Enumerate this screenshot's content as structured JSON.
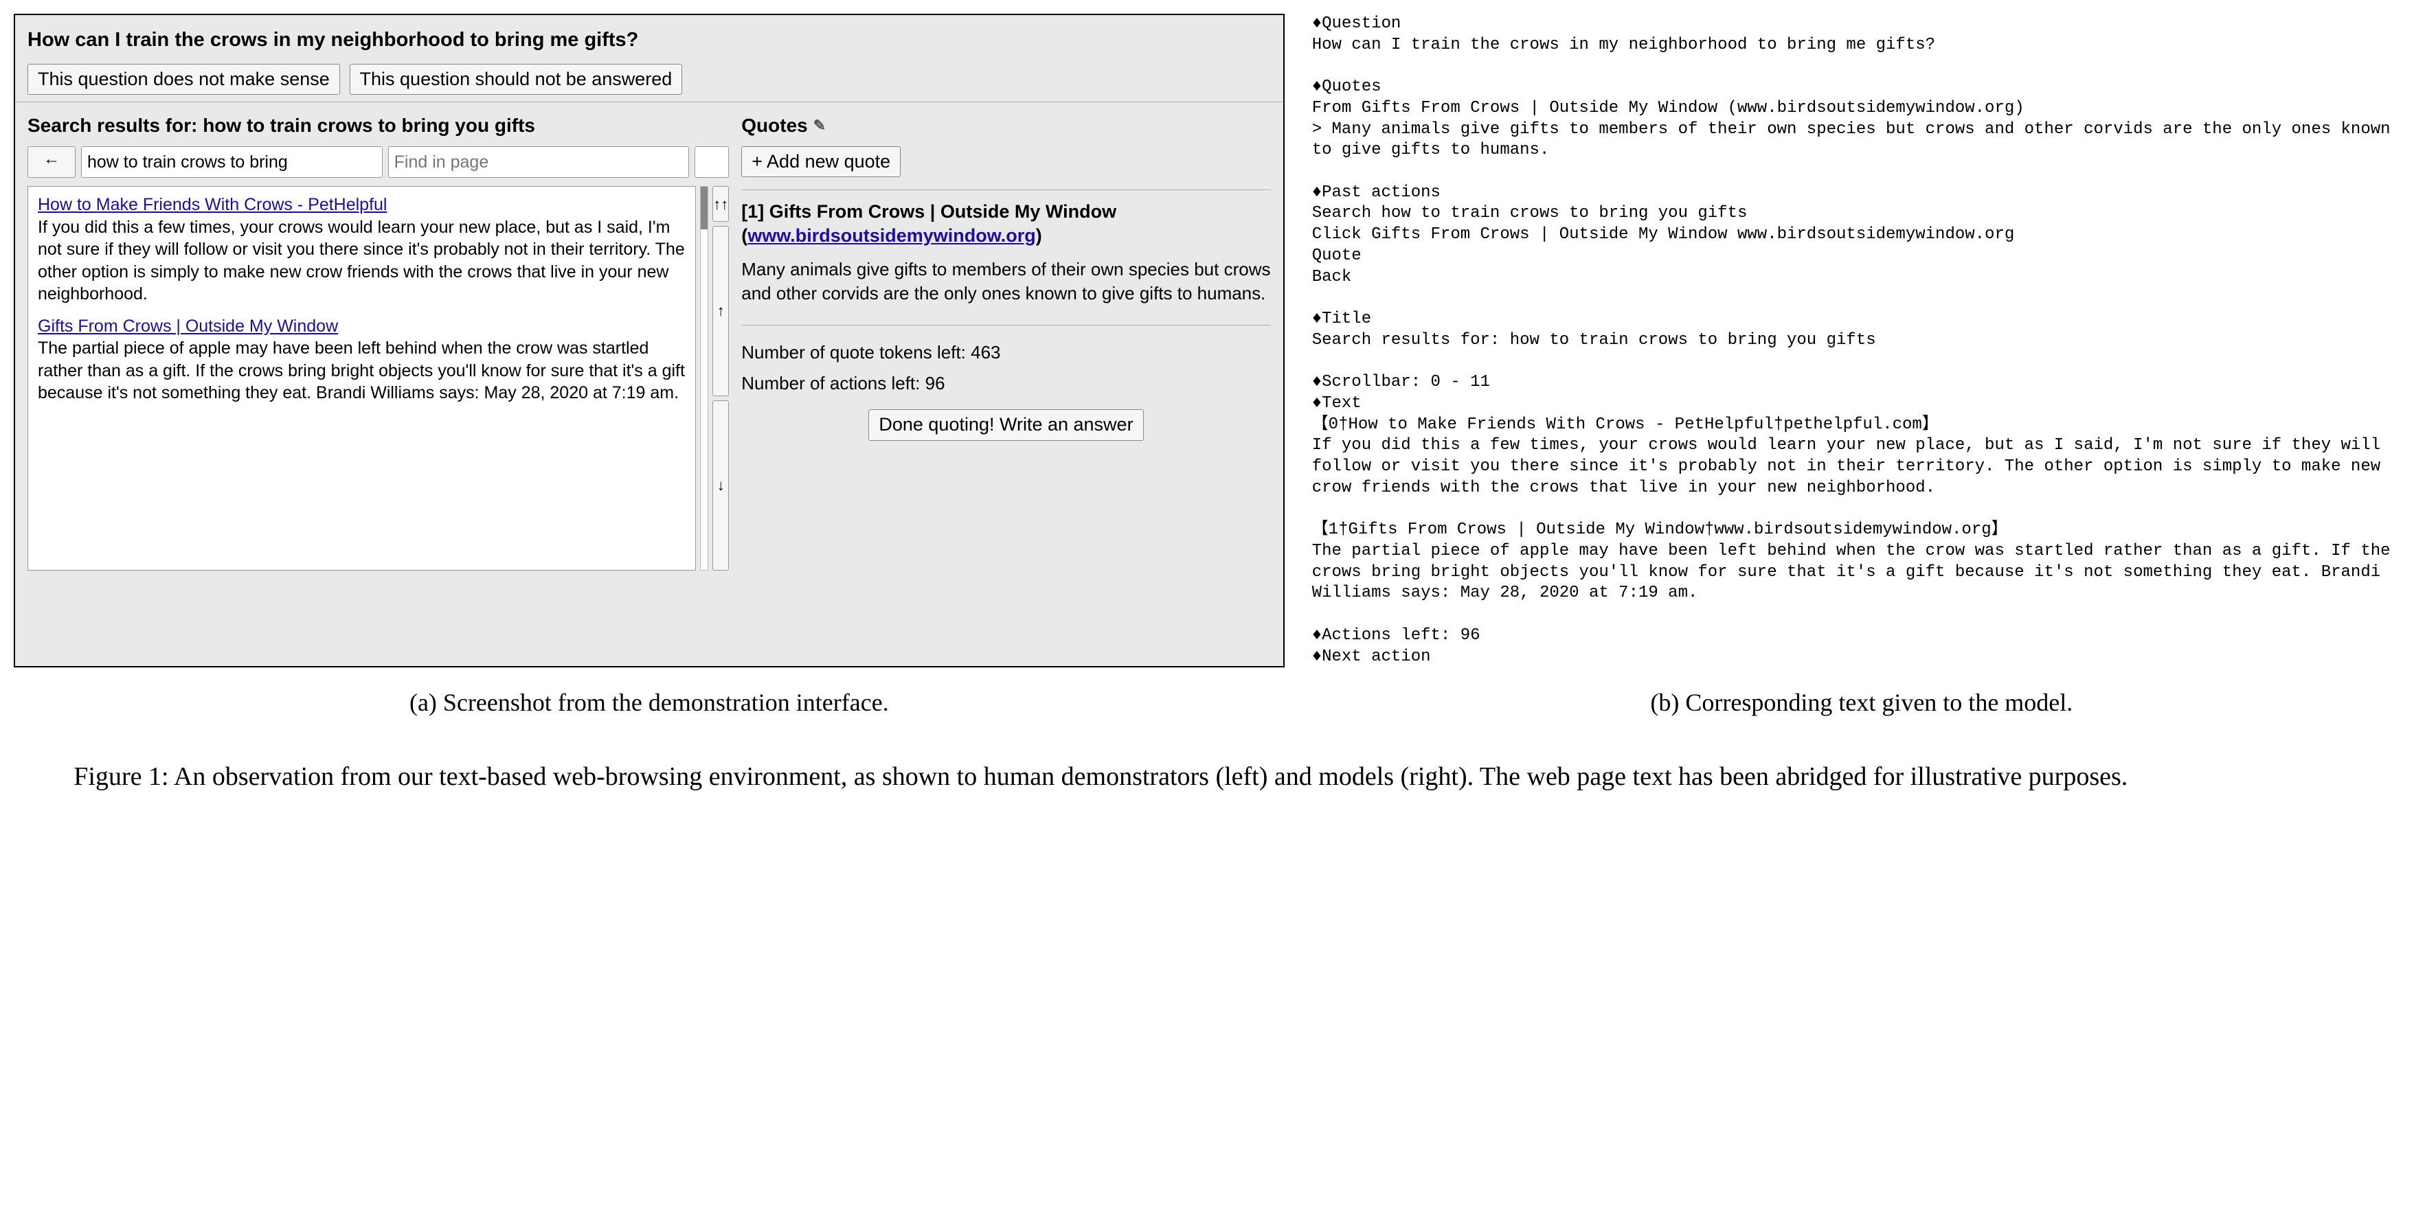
{
  "panel_a": {
    "question": "How can I train the crows in my neighborhood to bring me gifts?",
    "btn_no_sense": "This question does not make sense",
    "btn_no_answer": "This question should not be answered",
    "search_header_prefix": "Search results for: ",
    "search_header_query": "how to train crows to bring you gifts",
    "quotes_header": "Quotes",
    "back_arrow": "←",
    "search_value": "how to train crows to bring",
    "find_placeholder": "Find in page",
    "nav_top": "↑↑",
    "nav_up": "↑",
    "nav_down": "↓",
    "results": [
      {
        "title": "How to Make Friends With Crows - PetHelpful",
        "snippet": "If you did this a few times, your crows would learn your new place, but as I said, I'm not sure if they will follow or visit you there since it's probably not in their territory. The other option is simply to make new crow friends with the crows that live in your new neighborhood."
      },
      {
        "title": "Gifts From Crows | Outside My Window",
        "snippet": "The partial piece of apple may have been left behind when the crow was startled rather than as a gift. If the crows bring bright objects you'll know for sure that it's a gift because it's not something they eat. Brandi Williams says: May 28, 2020 at 7:19 am."
      }
    ],
    "add_quote_btn": "+ Add new quote",
    "quote_title_prefix": "[1] Gifts From Crows | Outside My Window (",
    "quote_title_link": "www.birdsoutsidemywindow.org",
    "quote_title_suffix": ")",
    "quote_body": "Many animals give gifts to members of their own species but crows and other corvids are the only ones known to give gifts to humans.",
    "tokens_left_label": "Number of quote tokens left: ",
    "tokens_left_value": "463",
    "actions_left_label": "Number of actions left: ",
    "actions_left_value": "96",
    "done_btn": "Done quoting! Write an answer"
  },
  "panel_b_text": "♦Question\nHow can I train the crows in my neighborhood to bring me gifts?\n\n♦Quotes\nFrom Gifts From Crows | Outside My Window (www.birdsoutsidemywindow.org)\n> Many animals give gifts to members of their own species but crows and other corvids are the only ones known to give gifts to humans.\n\n♦Past actions\nSearch how to train crows to bring you gifts\nClick Gifts From Crows | Outside My Window www.birdsoutsidemywindow.org\nQuote\nBack\n\n♦Title\nSearch results for: how to train crows to bring you gifts\n\n♦Scrollbar: 0 - 11\n♦Text\n【0†How to Make Friends With Crows - PetHelpful†pethelpful.com】\nIf you did this a few times, your crows would learn your new place, but as I said, I'm not sure if they will follow or visit you there since it's probably not in their territory. The other option is simply to make new crow friends with the crows that live in your new neighborhood.\n\n【1†Gifts From Crows | Outside My Window†www.birdsoutsidemywindow.org】\nThe partial piece of apple may have been left behind when the crow was startled rather than as a gift. If the crows bring bright objects you'll know for sure that it's a gift because it's not something they eat. Brandi Williams says: May 28, 2020 at 7:19 am.\n\n♦Actions left: 96\n♦Next action",
  "subcaption_a": "(a) Screenshot from the demonstration interface.",
  "subcaption_b": "(b) Corresponding text given to the model.",
  "figure_caption": "Figure 1:  An observation from our text-based web-browsing environment, as shown to human demonstrators (left) and models (right). The web page text has been abridged for illustrative purposes."
}
